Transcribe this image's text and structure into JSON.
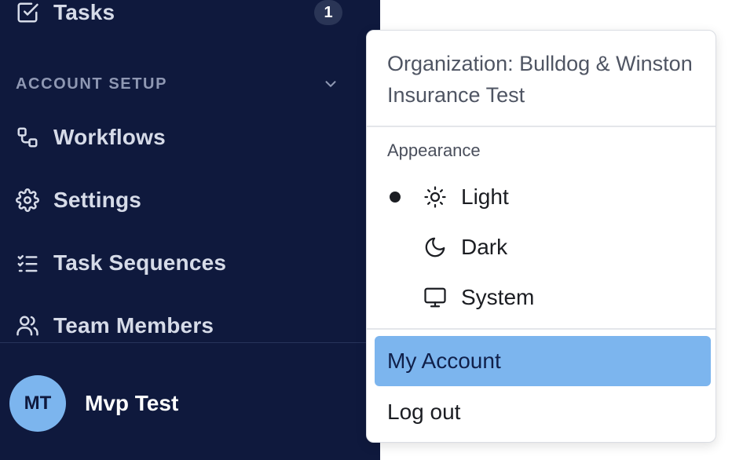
{
  "sidebar": {
    "tasks": {
      "label": "Tasks",
      "badge": "1",
      "icon": "checkbox-icon"
    },
    "section_title": "ACCOUNT SETUP",
    "items": [
      {
        "label": "Workflows",
        "icon": "workflow-icon"
      },
      {
        "label": "Settings",
        "icon": "gear-icon"
      },
      {
        "label": "Task Sequences",
        "icon": "list-checks-icon"
      },
      {
        "label": "Team Members",
        "icon": "users-icon"
      }
    ],
    "user": {
      "initials": "MT",
      "name": "Mvp Test"
    }
  },
  "dropdown": {
    "organization": "Organization: Bulldog & Winston Insurance Test",
    "appearance_label": "Appearance",
    "themes": [
      {
        "label": "Light",
        "icon": "sun-icon",
        "selected": true
      },
      {
        "label": "Dark",
        "icon": "moon-icon",
        "selected": false
      },
      {
        "label": "System",
        "icon": "monitor-icon",
        "selected": false
      }
    ],
    "my_account": "My Account",
    "logout": "Log out"
  },
  "colors": {
    "sidebar_bg": "#0f193d",
    "active_item": "#7cb5ee",
    "avatar": "#7cb5ee"
  }
}
